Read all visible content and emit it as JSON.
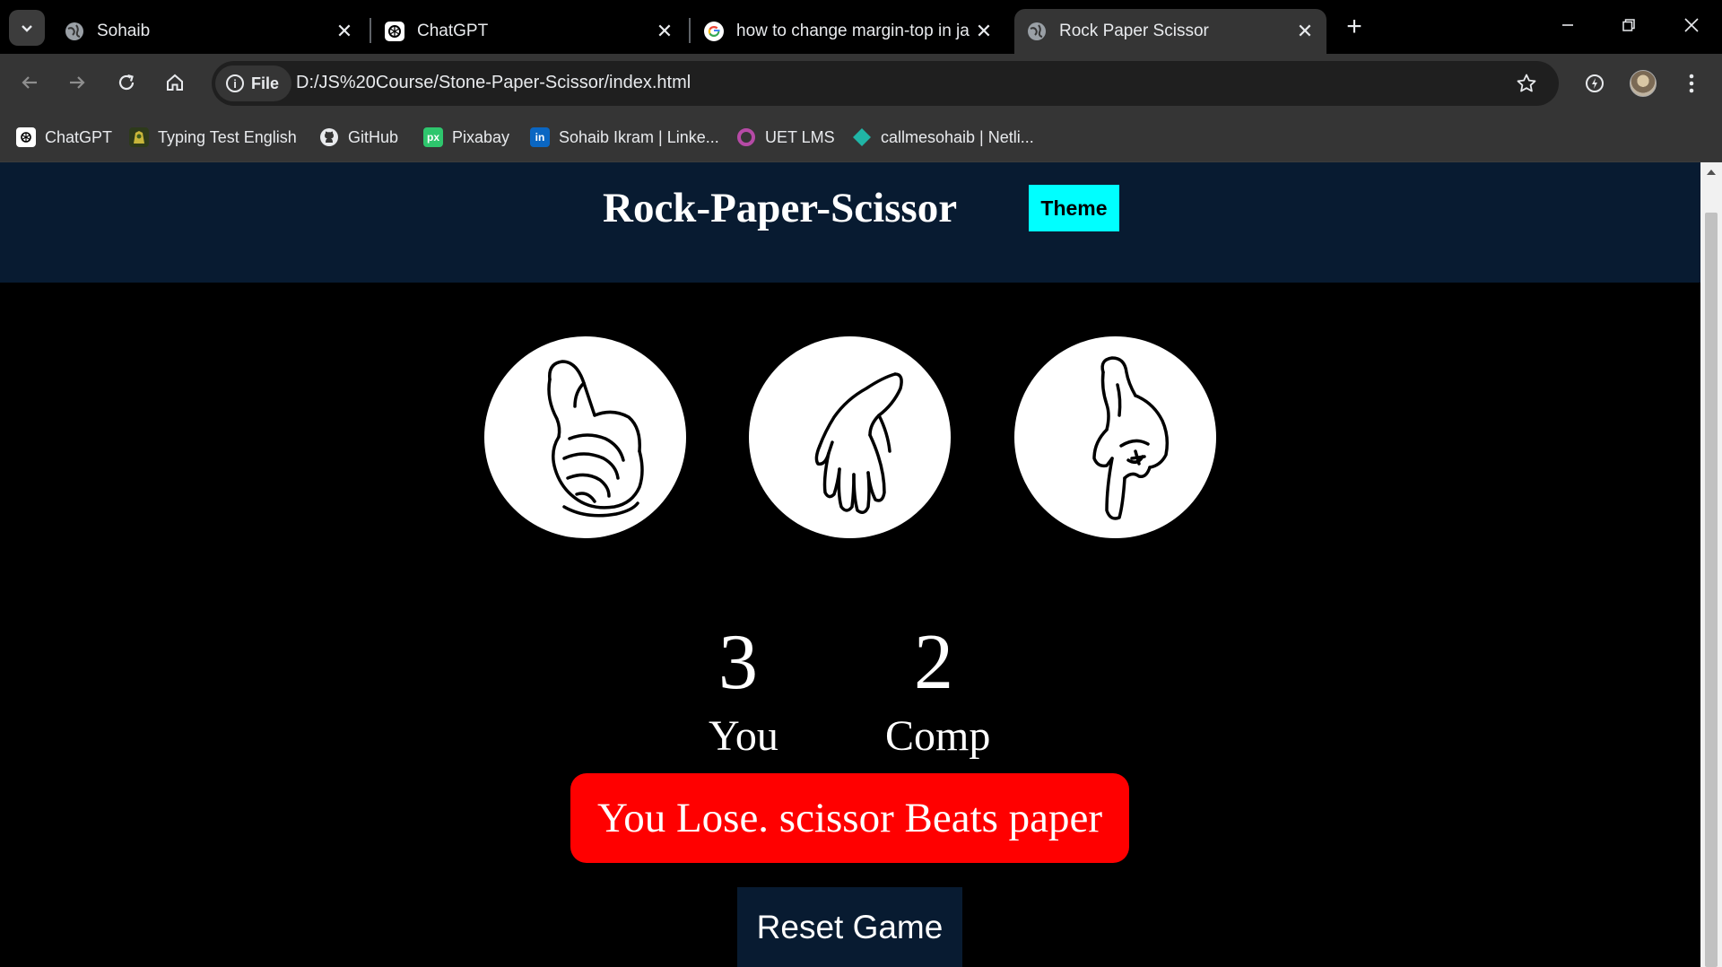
{
  "browser": {
    "tabs": [
      {
        "title": "Sohaib",
        "icon": "globe-icon"
      },
      {
        "title": "ChatGPT",
        "icon": "chatgpt-icon"
      },
      {
        "title": "how to change margin-top in ja",
        "icon": "google-icon"
      },
      {
        "title": "Rock Paper Scissor",
        "icon": "globe-icon",
        "active": true
      }
    ],
    "address": {
      "chip_label": "File",
      "url": "D:/JS%20Course/Stone-Paper-Scissor/index.html"
    },
    "bookmarks": [
      {
        "label": "ChatGPT",
        "icon": "chatgpt-icon"
      },
      {
        "label": "Typing Test English",
        "icon": "typing-icon"
      },
      {
        "label": "GitHub",
        "icon": "github-icon"
      },
      {
        "label": "Pixabay",
        "icon": "pixabay-icon",
        "icon_text": "px"
      },
      {
        "label": "Sohaib Ikram | Linke...",
        "icon": "linkedin-icon",
        "icon_text": "in"
      },
      {
        "label": "UET LMS",
        "icon": "ring-icon"
      },
      {
        "label": "callmesohaib | Netli...",
        "icon": "netlify-icon"
      }
    ]
  },
  "page": {
    "title": "Rock-Paper-Scissor",
    "theme_button": "Theme",
    "choices": [
      {
        "name": "rock",
        "icon": "rock-hand-icon"
      },
      {
        "name": "paper",
        "icon": "paper-hand-icon"
      },
      {
        "name": "scissor",
        "icon": "scissor-hand-icon"
      }
    ],
    "score": {
      "user": "3",
      "user_label": "You",
      "comp": "2",
      "comp_label": "Comp"
    },
    "message": "You Lose. scissor Beats paper",
    "reset_button": "Reset Game"
  },
  "colors": {
    "header_bg": "#081b31",
    "theme_button_bg": "#00ffff",
    "message_bg": "#ff0000",
    "page_bg": "#000000"
  }
}
